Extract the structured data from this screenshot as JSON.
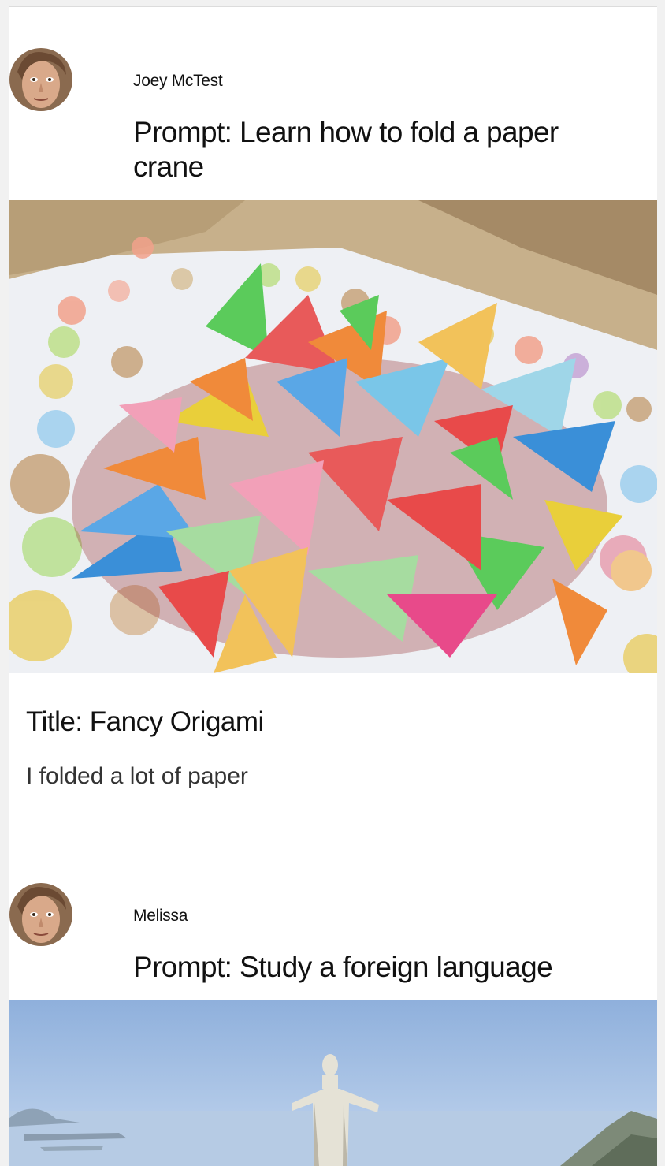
{
  "posts": [
    {
      "username": "Joey McTest",
      "prompt": "Prompt: Learn how to fold a paper crane",
      "title": "Title: Fancy Origami",
      "body": "I folded a lot of paper",
      "avatar_icon": "user-avatar-photo",
      "image_subject": "paper-cranes-photo"
    },
    {
      "username": "Melissa",
      "prompt": "Prompt: Study a foreign language",
      "avatar_icon": "user-avatar-photo",
      "image_subject": "statue-over-bay-photo"
    }
  ],
  "colors": {
    "page_bg": "#f1f1f1",
    "card_bg": "#ffffff",
    "text": "#111111",
    "sky": "#a9c4e6"
  }
}
